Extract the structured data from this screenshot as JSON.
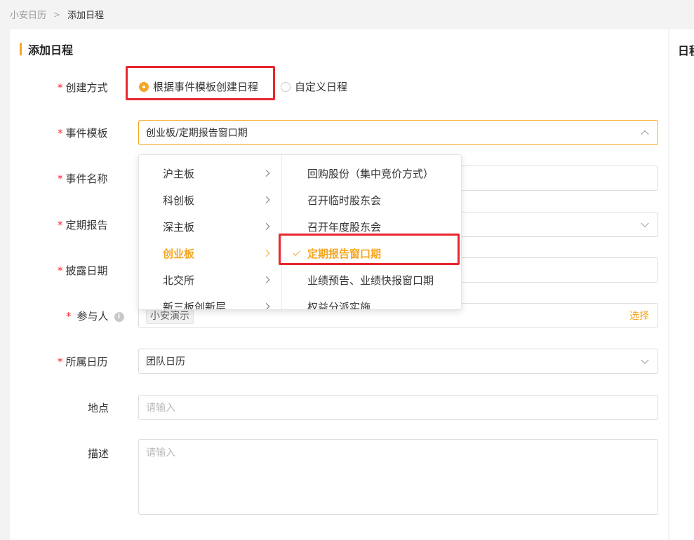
{
  "breadcrumb": {
    "parent": "小安日历",
    "current": "添加日程"
  },
  "section_title": "添加日程",
  "side_title": "日程",
  "form": {
    "create_mode": {
      "label": "创建方式",
      "required": "*",
      "options": [
        {
          "label": "根据事件模板创建日程",
          "checked": true
        },
        {
          "label": "自定义日程",
          "checked": false
        }
      ]
    },
    "event_template": {
      "label": "事件模板",
      "required": "*",
      "value": "创业板/定期报告窗口期"
    },
    "event_name": {
      "label": "事件名称",
      "required": "*",
      "value": ""
    },
    "periodic_report": {
      "label": "定期报告",
      "required": "*",
      "value": ""
    },
    "disclosure_date": {
      "label": "披露日期",
      "required": "*",
      "value": ""
    },
    "participants": {
      "label": "参与人",
      "required": "*",
      "info_icon": "info-icon",
      "tag": "小安演示",
      "select_link": "选择"
    },
    "calendar": {
      "label": "所属日历",
      "required": "*",
      "value": "团队日历"
    },
    "location": {
      "label": "地点",
      "placeholder": "请输入"
    },
    "description": {
      "label": "描述",
      "placeholder": "请输入"
    }
  },
  "cascader": {
    "level1": [
      "沪主板",
      "科创板",
      "深主板",
      "创业板",
      "北交所",
      "新三板创新层"
    ],
    "level1_active": "创业板",
    "level2": [
      "回购股份（集中竞价方式）",
      "召开临时股东会",
      "召开年度股东会",
      "定期报告窗口期",
      "业绩预告、业绩快报窗口期",
      "权益分派实施"
    ],
    "level2_active": "定期报告窗口期"
  },
  "colors": {
    "accent": "#f5a623",
    "required": "#f5222d",
    "highlight_box": "#e8262d"
  }
}
